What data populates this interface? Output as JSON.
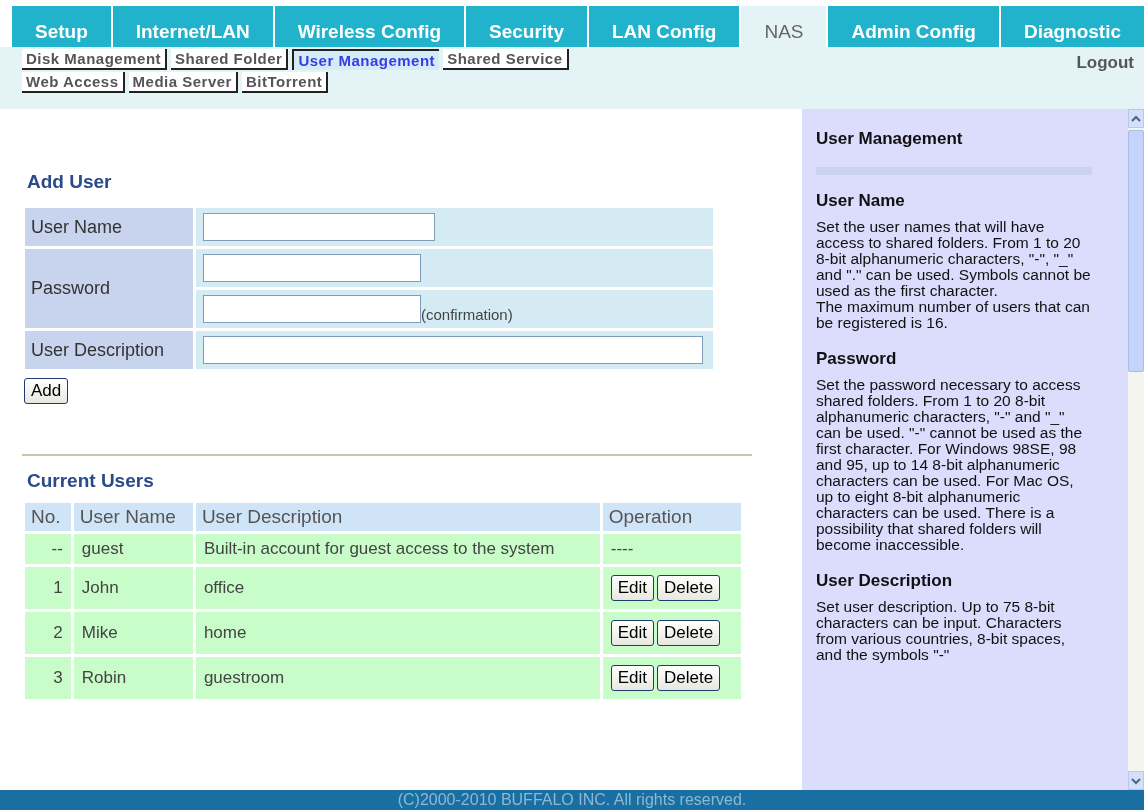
{
  "tabs": [
    {
      "label": "Setup",
      "selected": false
    },
    {
      "label": "Internet/LAN",
      "selected": false
    },
    {
      "label": "Wireless Config",
      "selected": false
    },
    {
      "label": "Security",
      "selected": false
    },
    {
      "label": "LAN Config",
      "selected": false
    },
    {
      "label": "NAS",
      "selected": true
    },
    {
      "label": "Admin Config",
      "selected": false
    },
    {
      "label": "Diagnostic",
      "selected": false
    }
  ],
  "subtabs": [
    [
      {
        "label": "Disk Management",
        "selected": false
      },
      {
        "label": "Shared Folder",
        "selected": false
      },
      {
        "label": "User Management",
        "selected": true
      },
      {
        "label": "Shared Service",
        "selected": false
      }
    ],
    [
      {
        "label": "Web Access",
        "selected": false
      },
      {
        "label": "Media Server",
        "selected": false
      },
      {
        "label": "BitTorrent",
        "selected": false
      }
    ]
  ],
  "logout": "Logout",
  "add_user": {
    "title": "Add User",
    "user_name_label": "User Name",
    "password_label": "Password",
    "confirmation_note": "(confirmation)",
    "description_label": "User Description",
    "add_button": "Add"
  },
  "current_users": {
    "title": "Current Users",
    "columns": [
      "No.",
      "User Name",
      "User Description",
      "Operation"
    ],
    "rows": [
      {
        "no": "--",
        "name": "guest",
        "description": "Built-in account for guest access to the system",
        "operation": "----"
      },
      {
        "no": "1",
        "name": "John",
        "description": "office",
        "buttons": [
          "Edit",
          "Delete"
        ]
      },
      {
        "no": "2",
        "name": "Mike",
        "description": "home",
        "buttons": [
          "Edit",
          "Delete"
        ]
      },
      {
        "no": "3",
        "name": "Robin",
        "description": "guestroom",
        "buttons": [
          "Edit",
          "Delete"
        ]
      }
    ]
  },
  "help": {
    "title": "User Management",
    "sections": [
      {
        "heading": "User Name",
        "paragraphs": [
          "Set the user names that will have access to shared folders. From 1 to 20 8-bit alphanumeric characters, \"-\", \"_\" and \".\" can be used. Symbols cannot be used as the first character.",
          "The maximum number of users that can be registered is 16."
        ]
      },
      {
        "heading": "Password",
        "paragraphs": [
          "Set the password necessary to access shared folders. From 1 to 20 8-bit alphanumeric characters, \"-\" and \"_\" can be used. \"-\" cannot be used as the first character. For Windows 98SE, 98 and 95, up to 14 8-bit alphanumeric characters can be used. For Mac OS, up to eight 8-bit alphanumeric characters can be used. There is a possibility that shared folders will become inaccessible."
        ]
      },
      {
        "heading": "User Description",
        "paragraphs": [
          "Set user description. Up to 75 8-bit characters can be input. Characters from various countries, 8-bit spaces, and the symbols \"-\""
        ]
      }
    ]
  },
  "footer": "(C)2000-2010 BUFFALO INC. All rights reserved."
}
